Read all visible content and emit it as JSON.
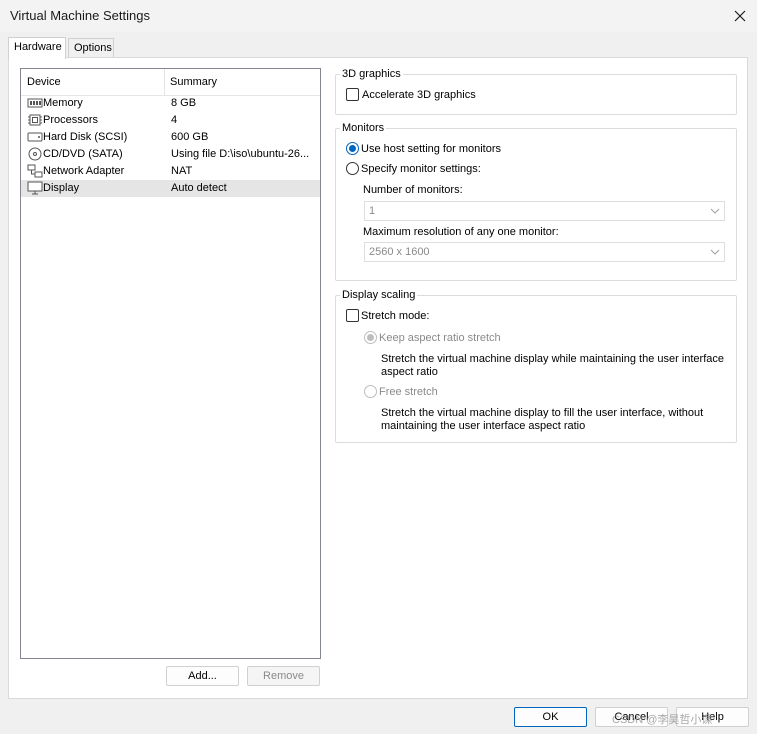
{
  "window": {
    "title": "Virtual Machine Settings"
  },
  "tabs": [
    {
      "label": "Hardware",
      "active": true
    },
    {
      "label": "Options",
      "active": false
    }
  ],
  "device_list": {
    "columns": [
      "Device",
      "Summary"
    ],
    "rows": [
      {
        "icon": "memory-icon",
        "name": "Memory",
        "summary": "8 GB",
        "selected": false
      },
      {
        "icon": "processor-icon",
        "name": "Processors",
        "summary": "4",
        "selected": false
      },
      {
        "icon": "hard-disk-icon",
        "name": "Hard Disk (SCSI)",
        "summary": "600 GB",
        "selected": false
      },
      {
        "icon": "cd-dvd-icon",
        "name": "CD/DVD (SATA)",
        "summary": "Using file D:\\iso\\ubuntu-26...",
        "selected": false
      },
      {
        "icon": "network-adapter-icon",
        "name": "Network Adapter",
        "summary": "NAT",
        "selected": false
      },
      {
        "icon": "display-icon",
        "name": "Display",
        "summary": "Auto detect",
        "selected": true
      }
    ],
    "add_label": "Add...",
    "remove_label": "Remove"
  },
  "graphics": {
    "title": "3D graphics",
    "accelerate_label": "Accelerate 3D graphics",
    "accelerate_checked": false
  },
  "monitors": {
    "title": "Monitors",
    "use_host_label": "Use host setting for monitors",
    "specify_label": "Specify monitor settings:",
    "selected": "use_host",
    "number_label": "Number of monitors:",
    "number_value": "1",
    "maxres_label": "Maximum resolution of any one monitor:",
    "maxres_value": "2560 x 1600"
  },
  "scaling": {
    "title": "Display scaling",
    "stretch_label": "Stretch mode:",
    "stretch_checked": false,
    "keep_label": "Keep aspect ratio stretch",
    "keep_desc": "Stretch the virtual machine display while maintaining the user interface aspect ratio",
    "free_label": "Free stretch",
    "free_desc": "Stretch the virtual machine display to fill the user interface, without maintaining the user interface aspect ratio"
  },
  "footer": {
    "ok_label": "OK",
    "cancel_label": "Cancel",
    "help_label": "Help"
  },
  "watermark": "CSDN @李昊哲小课",
  "colors": {
    "accent": "#0067c0",
    "selected_row": "#e5e5e5",
    "disabled_text": "#8a8a8a"
  }
}
